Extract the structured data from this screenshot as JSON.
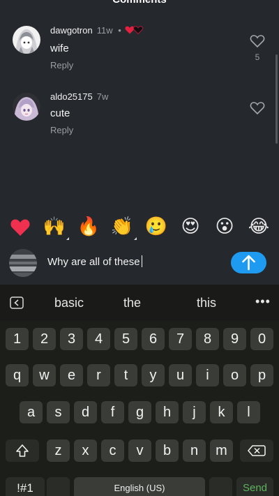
{
  "header": {
    "title": "Comments"
  },
  "comments": [
    {
      "username": "dawgotron",
      "time": "11w",
      "separator": "•",
      "text": "wife",
      "reply_label": "Reply",
      "like_count": "5",
      "liked_by_creator_icons": [
        "red-heart-icon",
        "black-heart-icon"
      ]
    },
    {
      "username": "aldo25175",
      "time": "7w",
      "text": "cute",
      "reply_label": "Reply"
    }
  ],
  "emoji_reactions": [
    {
      "glyph": "❤️",
      "name": "red-heart"
    },
    {
      "glyph": "🙌",
      "name": "raising-hands"
    },
    {
      "glyph": "🔥",
      "name": "fire"
    },
    {
      "glyph": "👏",
      "name": "clapping-hands"
    },
    {
      "glyph": "🥲",
      "name": "smiling-face-with-tear"
    },
    {
      "glyph": "😍",
      "name": "heart-eyes"
    },
    {
      "glyph": "😮",
      "name": "open-mouth"
    },
    {
      "glyph": "😂",
      "name": "tears-of-joy"
    }
  ],
  "compose": {
    "text": "Why are all of these",
    "send_icon": "up-arrow-icon",
    "send_color": "#1e9bf0"
  },
  "keyboard": {
    "suggestions": [
      "basic",
      "the",
      "this"
    ],
    "more_icon": "ellipsis-icon",
    "number_row": [
      "1",
      "2",
      "3",
      "4",
      "5",
      "6",
      "7",
      "8",
      "9",
      "0"
    ],
    "row1": [
      "q",
      "w",
      "e",
      "r",
      "t",
      "y",
      "u",
      "i",
      "o",
      "p"
    ],
    "row2": [
      "a",
      "s",
      "d",
      "f",
      "g",
      "h",
      "j",
      "k",
      "l"
    ],
    "row3": [
      "z",
      "x",
      "c",
      "v",
      "b",
      "n",
      "m"
    ],
    "symbols_label": "!#1",
    "space_label": "English (US)",
    "send_label": "Send",
    "send_label_color": "#5fb35f"
  }
}
